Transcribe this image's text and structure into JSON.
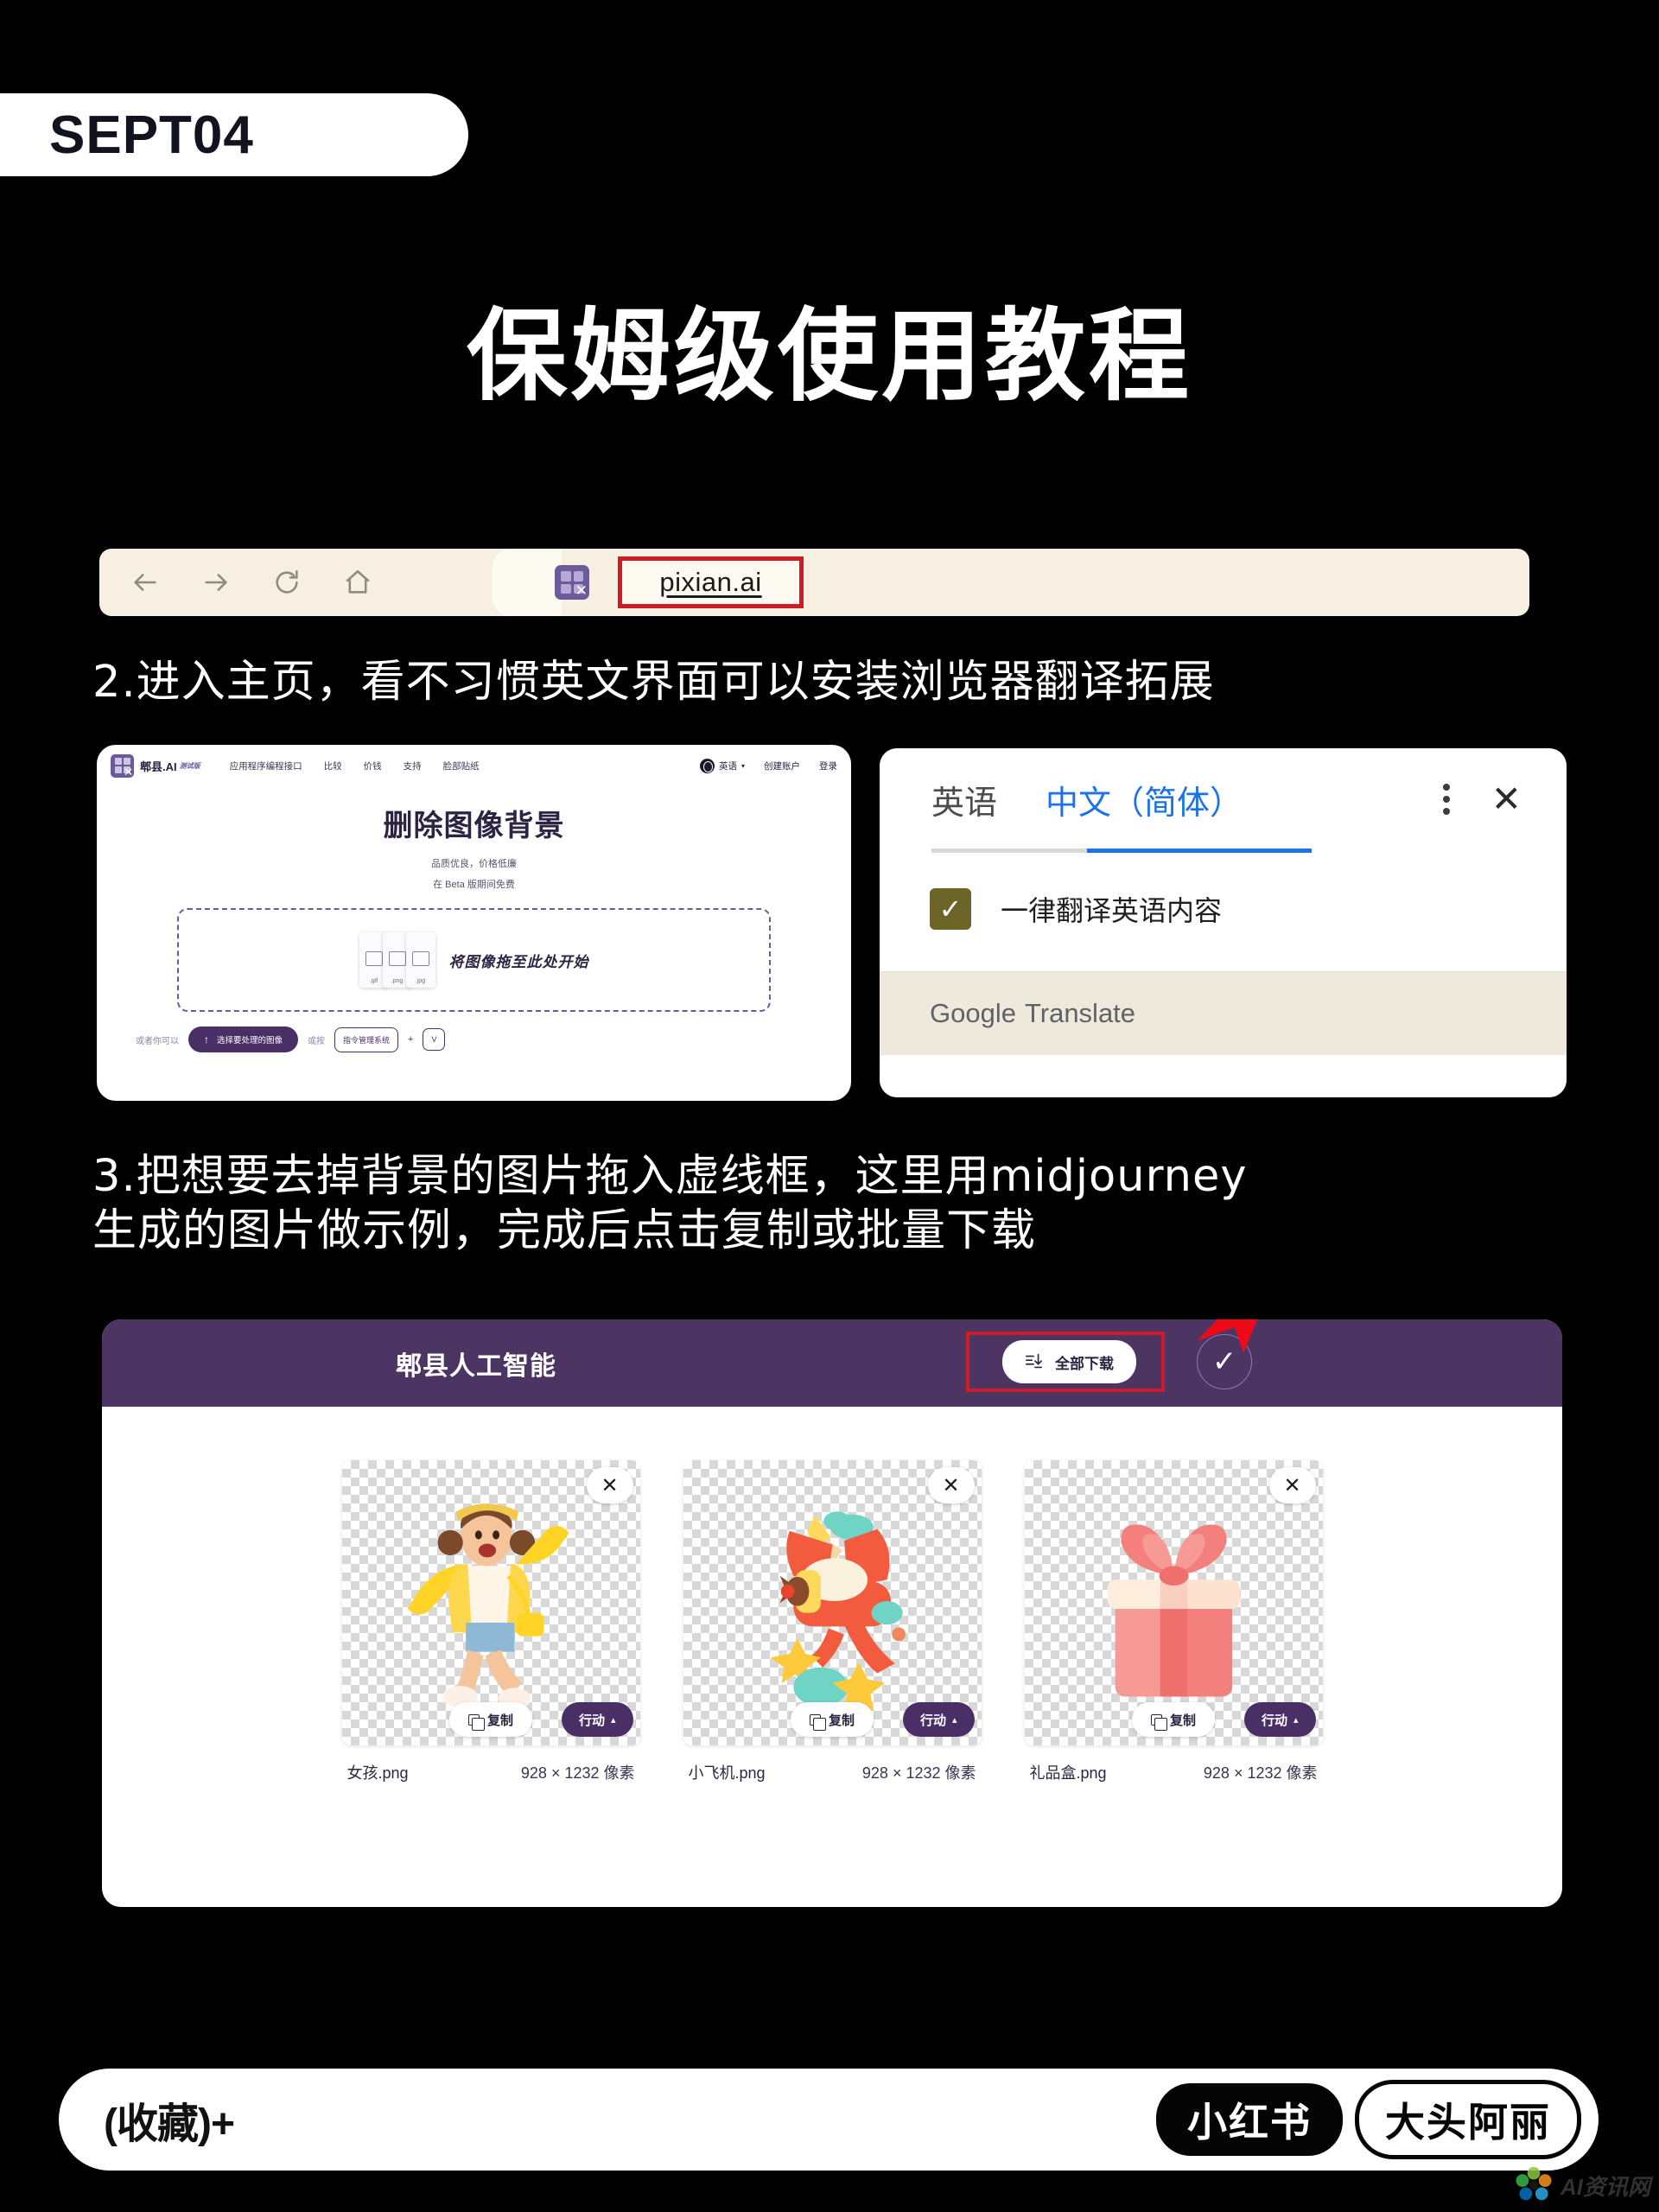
{
  "header": {
    "date_badge": "SEPT04",
    "title": "保姆级使用教程"
  },
  "browser": {
    "back_icon": "back-arrow-icon",
    "forward_icon": "forward-arrow-icon",
    "reload_icon": "reload-icon",
    "home_icon": "home-icon",
    "extension_icon": "pixian-extension-icon",
    "url": "pixian.ai",
    "highlight_color": "#d01a26"
  },
  "steps": {
    "step2": "2.进入主页，看不习惯英文界面可以安装浏览器翻译拓展",
    "step3_line1": "3.把想要去掉背景的图片拖入虚线框，这里用midjourney",
    "step3_line2": "生成的图片做示例，完成后点击复制或批量下载"
  },
  "site": {
    "brand": "郫县.AI",
    "brand_beta": "测试版",
    "nav_links": [
      "应用程序编程接口",
      "比较",
      "价钱",
      "支持",
      "脸部贴纸"
    ],
    "language": "英语",
    "language_caret": "▾",
    "create_account": "创建账户",
    "login": "登录",
    "title": "删除图像背景",
    "subtitle1": "品质优良，价格低廉",
    "subtitle2": "在 Beta 版期间免费",
    "dropzone_text": "将图像拖至此处开始",
    "file_labels": [
      ".gif",
      ".png",
      ".jpg"
    ],
    "or_you_can": "或者你可以",
    "choose_button": "选择要处理的图像",
    "or_press": "或按",
    "shortcut_key": "指令管理系统",
    "plus": "+",
    "shortcut_key2": "V"
  },
  "translate": {
    "tab_source": "英语",
    "tab_target": "中文（简体）",
    "kebab_icon": "kebab-menu-icon",
    "close_icon": "close-icon",
    "checkbox_label": "一律翻译英语内容",
    "checkbox_checked": "✓",
    "footer_brand": "Google",
    "footer_product": "Translate",
    "accent_color": "#1a73e8",
    "checkbox_color": "#6d6427"
  },
  "result": {
    "header_title": "郫县人工智能",
    "download_all": "全部下载",
    "download_icon": "download-all-icon",
    "check_icon": "check-circle-icon",
    "header_color": "#4d3563",
    "highlight_color": "#d01a26",
    "arrow_color": "#ee0a18",
    "items": [
      {
        "name": "女孩.png",
        "dimensions": "928 × 1232 像素",
        "art": "girl-jumping-art",
        "close": "✕",
        "copy": "复制",
        "action": "行动",
        "caret": "▴"
      },
      {
        "name": "小飞机.png",
        "dimensions": "928 × 1232 像素",
        "art": "toy-airplane-art",
        "close": "✕",
        "copy": "复制",
        "action": "行动",
        "caret": "▴"
      },
      {
        "name": "礼品盒.png",
        "dimensions": "928 × 1232 像素",
        "art": "gift-box-art",
        "close": "✕",
        "copy": "复制",
        "action": "行动",
        "caret": "▴"
      }
    ]
  },
  "footer": {
    "favorite": "(收藏)+",
    "platform": "小红书",
    "author": "大头阿丽",
    "watermark": "AI资讯网"
  }
}
